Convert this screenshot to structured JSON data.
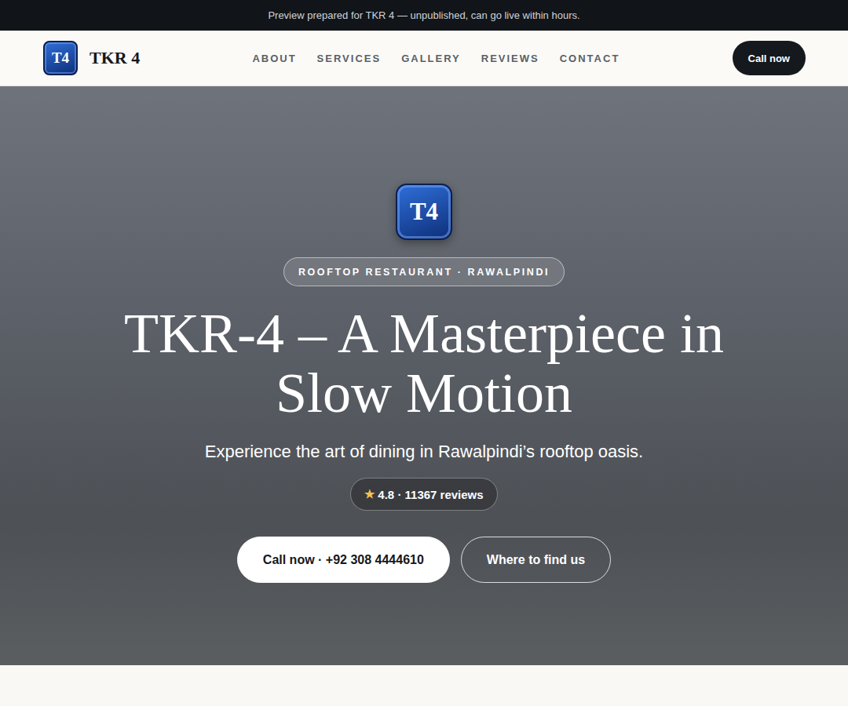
{
  "banner": {
    "text": "Preview prepared for TKR 4 — unpublished, can go live within hours."
  },
  "header": {
    "logo": "T4",
    "brand": "TKR 4",
    "nav": [
      {
        "label": "ABOUT"
      },
      {
        "label": "SERVICES"
      },
      {
        "label": "GALLERY"
      },
      {
        "label": "REVIEWS"
      },
      {
        "label": "CONTACT"
      }
    ],
    "cta": "Call now"
  },
  "hero": {
    "logo": "T4",
    "badge": "ROOFTOP RESTAURANT · RAWALPINDI",
    "title": "TKR-4 – A Masterpiece in Slow Motion",
    "subtitle": "Experience the art of dining in Rawalpindi’s rooftop oasis.",
    "rating": {
      "star": "★",
      "text": "4.8 · 11367 reviews"
    },
    "buttons": [
      {
        "label": "Call now · +92 308 4444610",
        "kind": "primary"
      },
      {
        "label": "Where to find us",
        "kind": "outline"
      }
    ]
  }
}
